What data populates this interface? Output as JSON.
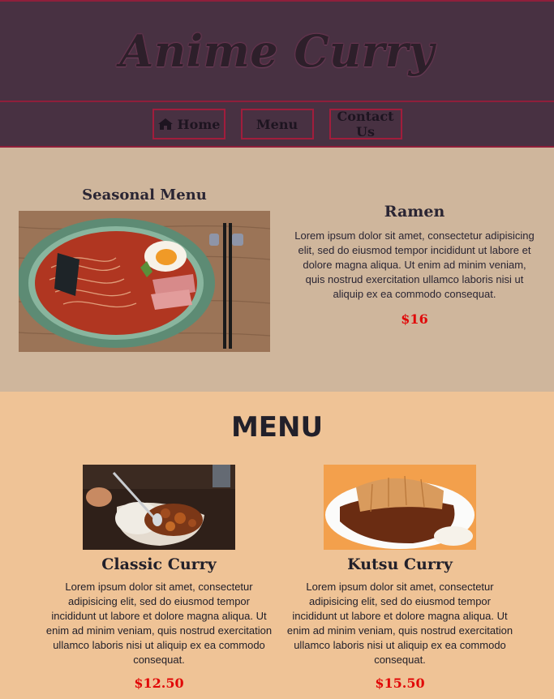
{
  "site": {
    "title": "Anime Curry"
  },
  "nav": {
    "home": "Home",
    "menu": "Menu",
    "contact": "Contact Us"
  },
  "seasonal": {
    "heading": "Seasonal Menu",
    "item": {
      "name": "Ramen",
      "description": "Lorem ipsum dolor sit amet, consectetur adipisicing elit, sed do eiusmod tempor incididunt ut labore et dolore magna aliqua. Ut enim ad minim veniam, quis nostrud exercitation ullamco laboris nisi ut aliquip ex ea commodo consequat.",
      "price": "$16"
    }
  },
  "menu": {
    "heading": "MENU",
    "items": [
      {
        "name": "Classic Curry",
        "description": "Lorem ipsum dolor sit amet, consectetur adipisicing elit, sed do eiusmod tempor incididunt ut labore et dolore magna aliqua. Ut enim ad minim veniam, quis nostrud exercitation ullamco laboris nisi ut aliquip ex ea commodo consequat.",
        "price": "$12.50"
      },
      {
        "name": "Kutsu Curry",
        "description": "Lorem ipsum dolor sit amet, consectetur adipisicing elit, sed do eiusmod tempor incididunt ut labore et dolore magna aliqua. Ut enim ad minim veniam, quis nostrud exercitation ullamco laboris nisi ut aliquip ex ea commodo consequat.",
        "price": "$15.50"
      }
    ]
  },
  "colors": {
    "header_bg": "#483142",
    "border": "#a11d3c",
    "seasonal_bg": "#cfb69c",
    "menu_bg": "#efc396",
    "price": "#e10808"
  },
  "icons": {
    "home": "home-icon"
  }
}
